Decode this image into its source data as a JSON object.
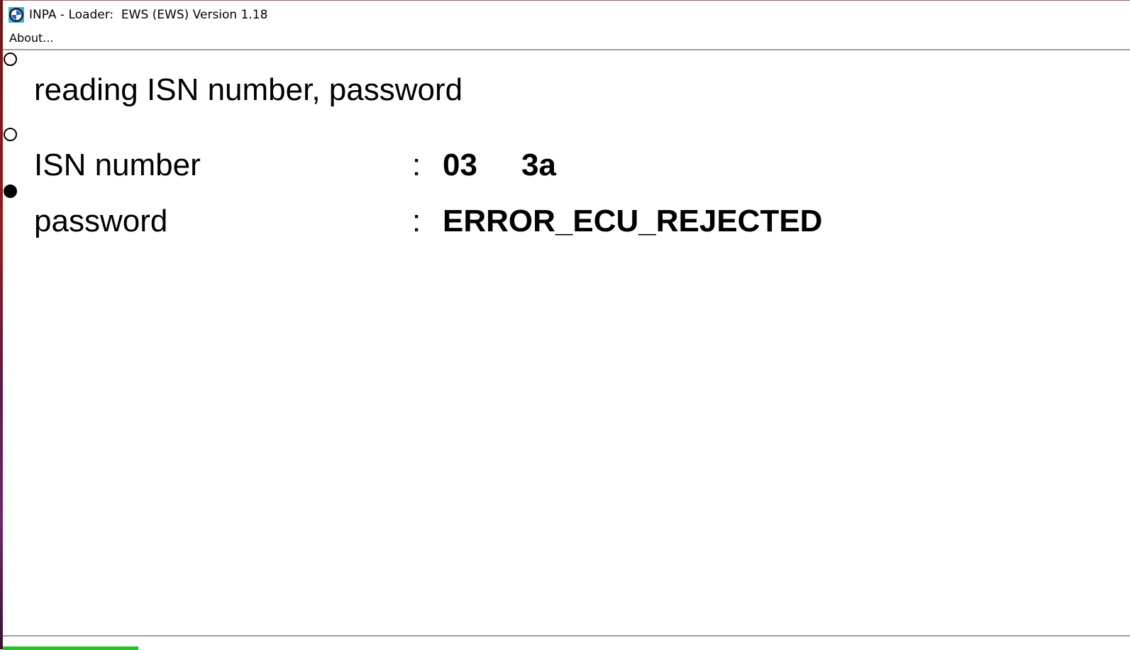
{
  "window": {
    "title": "INPA - Loader:  EWS (EWS) Version 1.18"
  },
  "menu": {
    "about_label": "About..."
  },
  "content": {
    "heading": "reading ISN number, password",
    "rows": [
      {
        "label": "ISN number",
        "separator": ":",
        "value_1": "03",
        "value_2": "3a"
      },
      {
        "label": "password",
        "separator": ":",
        "value_1": "ERROR_ECU_REJECTED"
      }
    ]
  },
  "status": {
    "progress_fraction": 0.12,
    "progress_color": "#22c322"
  },
  "colors": {
    "background": "#ffffff",
    "text": "#000000"
  }
}
